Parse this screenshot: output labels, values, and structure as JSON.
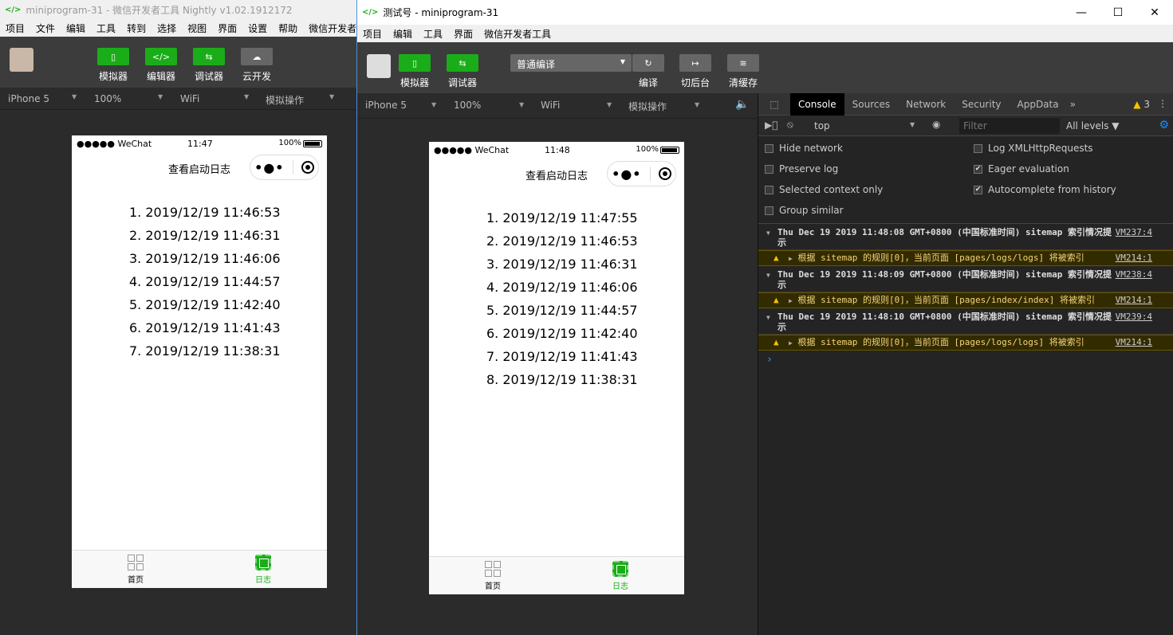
{
  "win1": {
    "title": "miniprogram-31 - 微信开发者工具 Nightly v1.02.1912172",
    "menu": [
      "项目",
      "文件",
      "编辑",
      "工具",
      "转到",
      "选择",
      "视图",
      "界面",
      "设置",
      "帮助",
      "微信开发者工具"
    ],
    "toolbar": [
      "模拟器",
      "编辑器",
      "调试器",
      "云开发"
    ],
    "device": "iPhone 5",
    "zoom": "100%",
    "network": "WiFi",
    "simulate": "模拟操作",
    "phone": {
      "carrier": "●●●●● WeChat",
      "time": "11:47",
      "battery": "100%",
      "nav_title": "查看启动日志",
      "items": [
        "1. 2019/12/19 11:46:53",
        "2. 2019/12/19 11:46:31",
        "3. 2019/12/19 11:46:06",
        "4. 2019/12/19 11:44:57",
        "5. 2019/12/19 11:42:40",
        "6. 2019/12/19 11:41:43",
        "7. 2019/12/19 11:38:31"
      ],
      "tabs": [
        "首页",
        "日志"
      ]
    }
  },
  "win2": {
    "title": "测试号 - miniprogram-31",
    "menu": [
      "项目",
      "编辑",
      "工具",
      "界面",
      "微信开发者工具"
    ],
    "toolbar": [
      "模拟器",
      "调试器"
    ],
    "compile_mode": "普通编译",
    "actions": [
      "编译",
      "切后台",
      "清缓存"
    ],
    "device": "iPhone 5",
    "zoom": "100%",
    "network": "WiFi",
    "simulate": "模拟操作",
    "phone": {
      "carrier": "●●●●● WeChat",
      "time": "11:48",
      "battery": "100%",
      "nav_title": "查看启动日志",
      "items": [
        "1. 2019/12/19 11:47:55",
        "2. 2019/12/19 11:46:53",
        "3. 2019/12/19 11:46:31",
        "4. 2019/12/19 11:46:06",
        "5. 2019/12/19 11:44:57",
        "6. 2019/12/19 11:42:40",
        "7. 2019/12/19 11:41:43",
        "8. 2019/12/19 11:38:31"
      ],
      "tabs": [
        "首页",
        "日志"
      ]
    }
  },
  "devtools": {
    "tabs": [
      "Console",
      "Sources",
      "Network",
      "Security",
      "AppData"
    ],
    "more": "»",
    "warn_count": "3",
    "context": "top",
    "filter_placeholder": "Filter",
    "levels": "All levels ▼",
    "options": [
      {
        "label": "Hide network",
        "checked": false
      },
      {
        "label": "Log XMLHttpRequests",
        "checked": false
      },
      {
        "label": "Preserve log",
        "checked": false
      },
      {
        "label": "Eager evaluation",
        "checked": true
      },
      {
        "label": "Selected context only",
        "checked": false
      },
      {
        "label": "Autocomplete from history",
        "checked": true
      },
      {
        "label": "Group similar",
        "checked": false
      }
    ],
    "logs": [
      {
        "group": "Thu Dec 19 2019 11:48:08 GMT+0800 (中国标准时间) sitemap 索引情况提示",
        "src": "VM237:4",
        "warn": "根据 sitemap 的规则[0]，当前页面 [pages/logs/logs] 将被索引",
        "wsrc": "VM214:1"
      },
      {
        "group": "Thu Dec 19 2019 11:48:09 GMT+0800 (中国标准时间) sitemap 索引情况提示",
        "src": "VM238:4",
        "warn": "根据 sitemap 的规则[0]，当前页面 [pages/index/index] 将被索引",
        "wsrc": "VM214:1"
      },
      {
        "group": "Thu Dec 19 2019 11:48:10 GMT+0800 (中国标准时间) sitemap 索引情况提示",
        "src": "VM239:4",
        "warn": "根据 sitemap 的规则[0]，当前页面 [pages/logs/logs] 将被索引",
        "wsrc": "VM214:1"
      }
    ],
    "prompt": "›"
  },
  "colors": {
    "accent": "#1aad19",
    "warn_bg": "#332b00",
    "warn_text": "#f5d67b"
  }
}
